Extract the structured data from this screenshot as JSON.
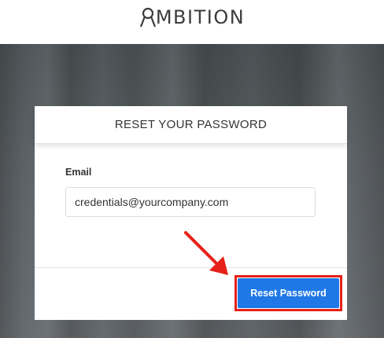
{
  "header": {
    "logo_text": "MBITION",
    "logo_icon": "ambition-a-icon"
  },
  "form": {
    "title": "RESET YOUR PASSWORD",
    "email_label": "Email",
    "email_value": "credentials@yourcompany.com",
    "submit_label": "Reset Password"
  },
  "annotation": {
    "arrow_icon": "red-arrow-icon",
    "highlight_color": "#e62117"
  },
  "colors": {
    "button": "#1f78e6",
    "annotation": "#e62117"
  }
}
